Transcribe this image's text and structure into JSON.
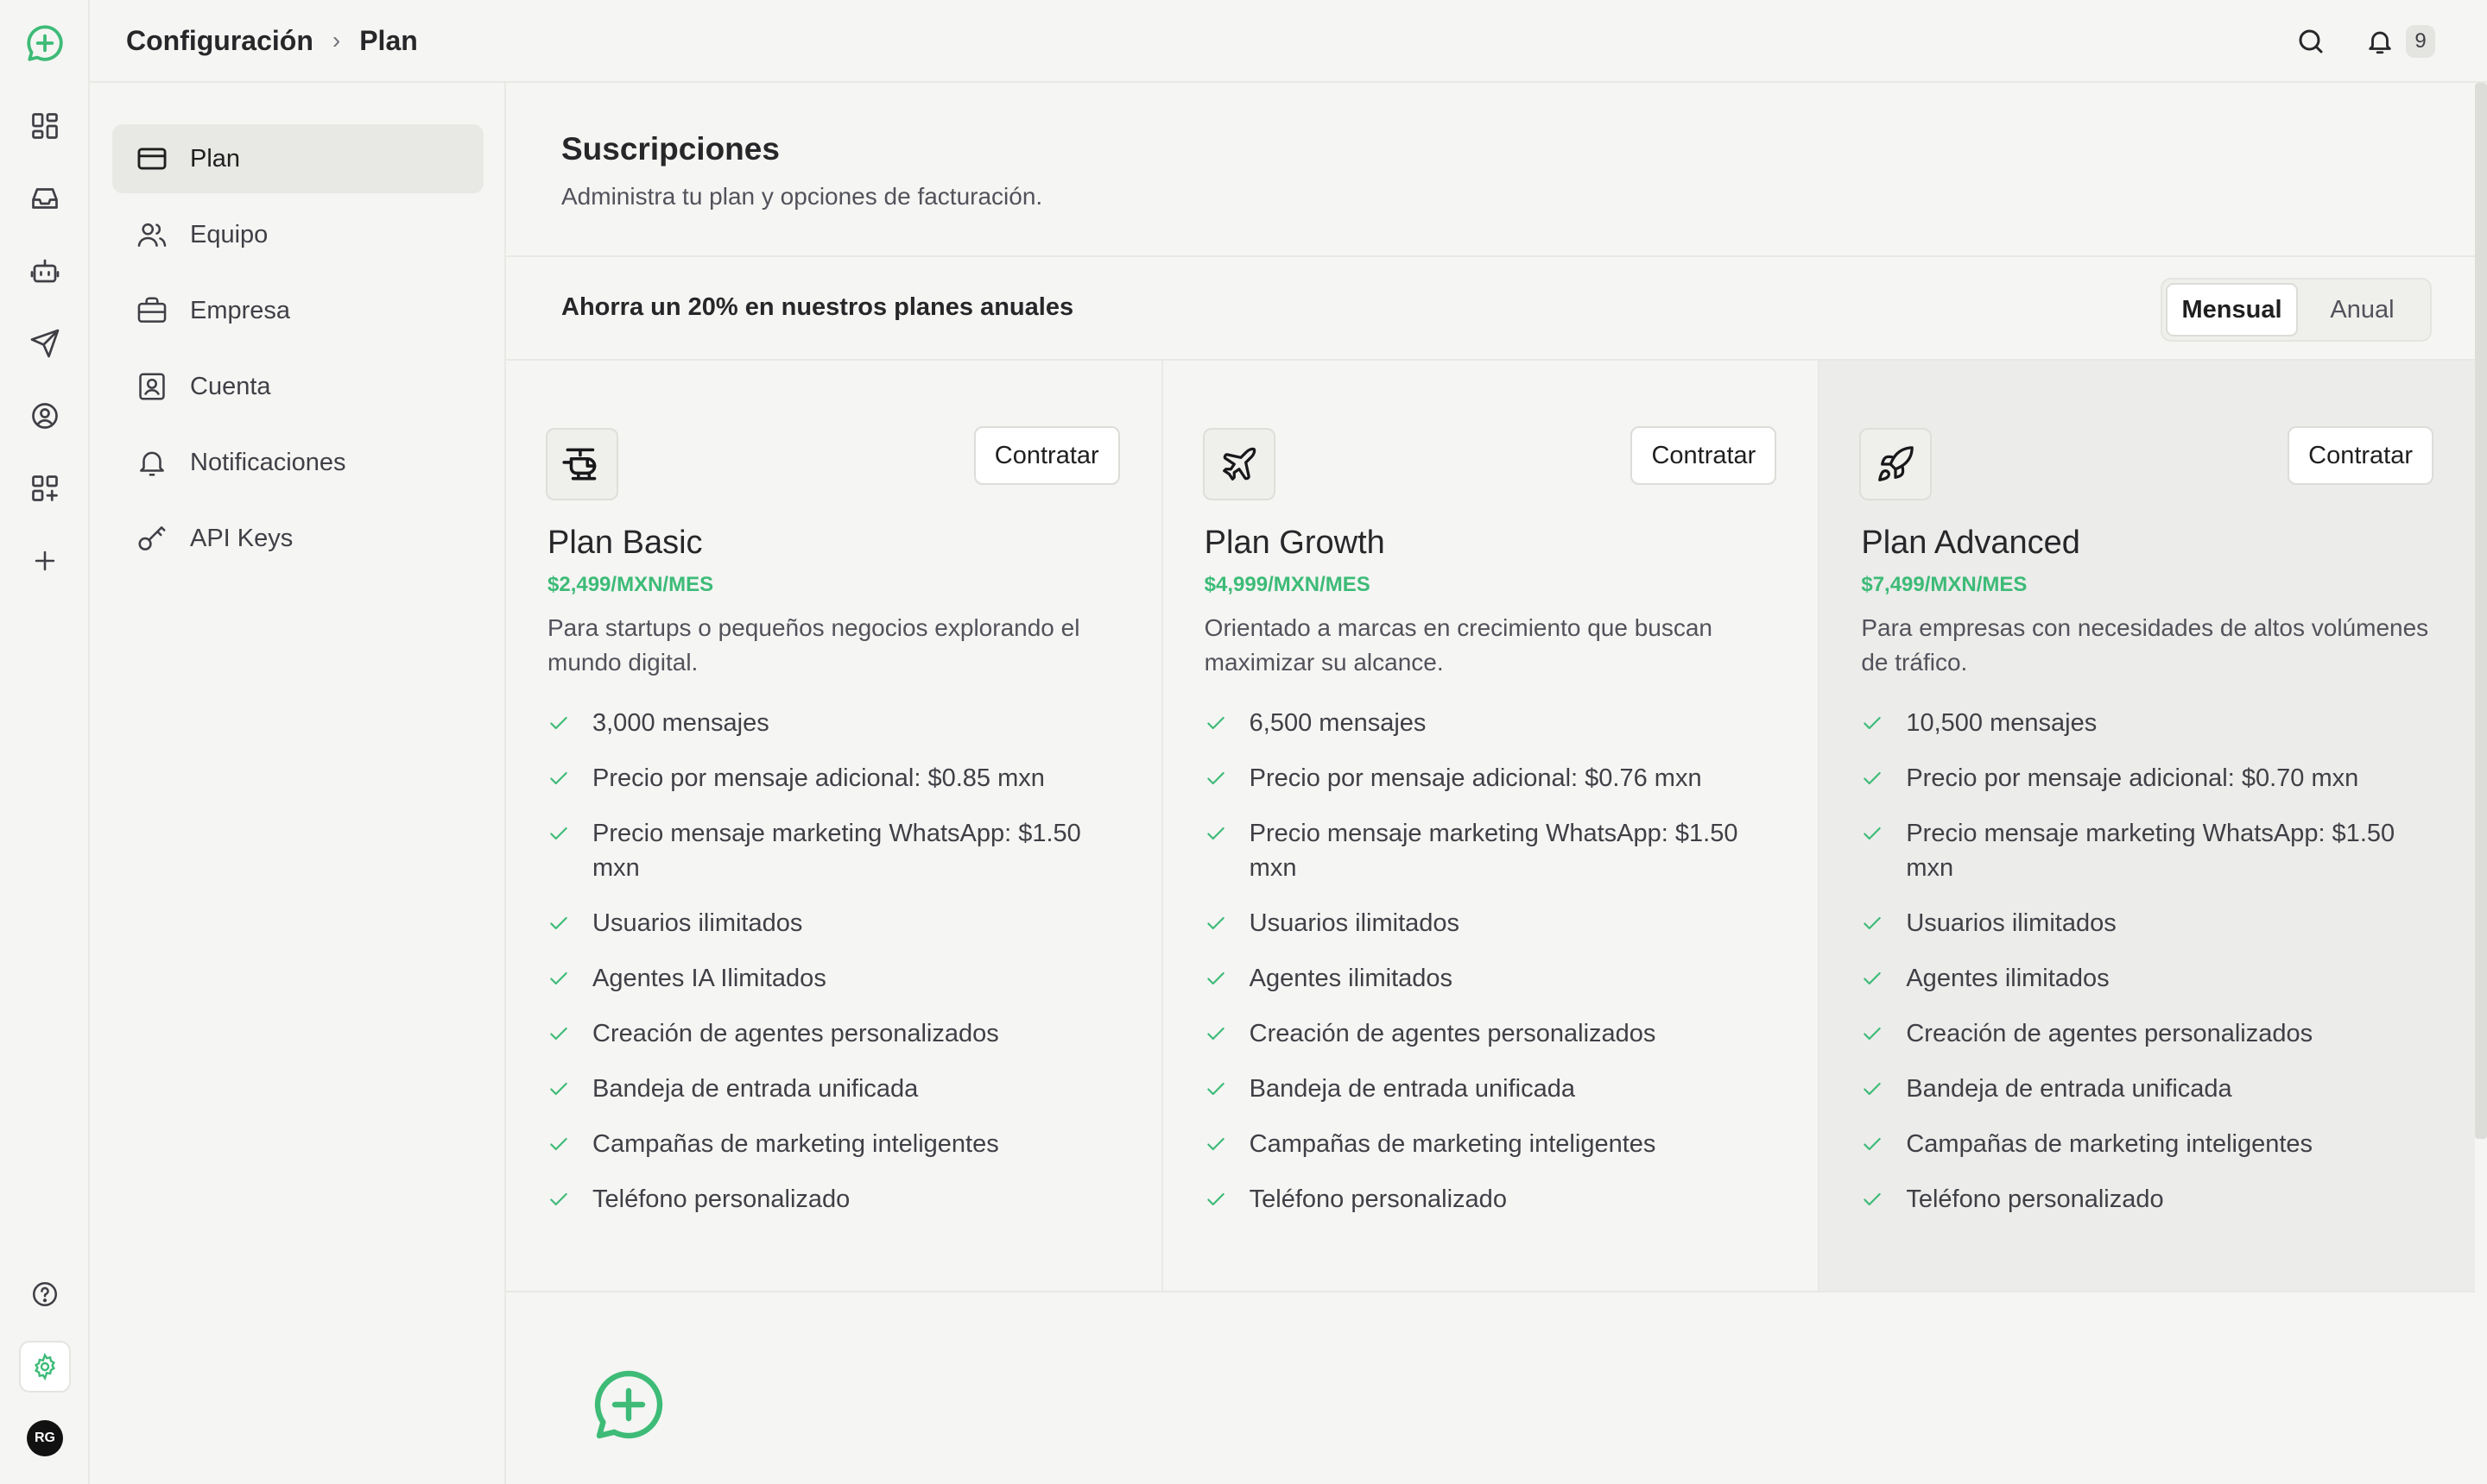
{
  "rail": {
    "avatar_initials": "RG"
  },
  "header": {
    "breadcrumb": [
      "Configuración",
      "Plan"
    ],
    "notification_count": "9"
  },
  "sidebar": {
    "items": [
      {
        "label": "Plan",
        "icon": "credit-card-icon"
      },
      {
        "label": "Equipo",
        "icon": "users-icon"
      },
      {
        "label": "Empresa",
        "icon": "briefcase-icon"
      },
      {
        "label": "Cuenta",
        "icon": "contact-card-icon"
      },
      {
        "label": "Notificaciones",
        "icon": "bell-icon"
      },
      {
        "label": "API Keys",
        "icon": "key-icon"
      }
    ]
  },
  "main": {
    "title": "Suscripciones",
    "subtitle": "Administra tu plan y opciones de facturación.",
    "promo": "Ahorra un 20% en nuestros planes anuales",
    "billing_toggle": {
      "monthly": "Mensual",
      "annual": "Anual",
      "selected": "Mensual"
    }
  },
  "plans": [
    {
      "name": "Plan Basic",
      "price": "$2,499/MXN/MES",
      "description": "Para startups o pequeños negocios explorando el mundo digital.",
      "button": "Contratar",
      "icon": "helicopter-icon",
      "features": [
        "3,000 mensajes",
        "Precio por mensaje adicional: $0.85 mxn",
        "Precio mensaje marketing WhatsApp: $1.50 mxn",
        "Usuarios ilimitados",
        "Agentes IA Ilimitados",
        "Creación de agentes personalizados",
        "Bandeja de entrada unificada",
        "Campañas de marketing inteligentes",
        "Teléfono personalizado"
      ]
    },
    {
      "name": "Plan Growth",
      "price": "$4,999/MXN/MES",
      "description": "Orientado a marcas en crecimiento que buscan maximizar su alcance.",
      "button": "Contratar",
      "icon": "plane-icon",
      "features": [
        "6,500 mensajes",
        "Precio por mensaje adicional: $0.76 mxn",
        "Precio mensaje marketing WhatsApp: $1.50 mxn",
        "Usuarios ilimitados",
        "Agentes ilimitados",
        "Creación de agentes personalizados",
        "Bandeja de entrada unificada",
        "Campañas de marketing inteligentes",
        "Teléfono personalizado"
      ]
    },
    {
      "name": "Plan Advanced",
      "price": "$7,499/MXN/MES",
      "description": "Para empresas con necesidades de altos volúmenes de tráfico.",
      "button": "Contratar",
      "icon": "rocket-icon",
      "features": [
        "10,500 mensajes",
        "Precio por mensaje adicional: $0.70 mxn",
        "Precio mensaje marketing WhatsApp: $1.50 mxn",
        "Usuarios ilimitados",
        "Agentes ilimitados",
        "Creación de agentes personalizados",
        "Bandeja de entrada unificada",
        "Campañas de marketing inteligentes",
        "Teléfono personalizado"
      ]
    }
  ],
  "colors": {
    "accent": "#3dbb77",
    "background": "#f5f5f3",
    "border": "#e8e8e5"
  }
}
